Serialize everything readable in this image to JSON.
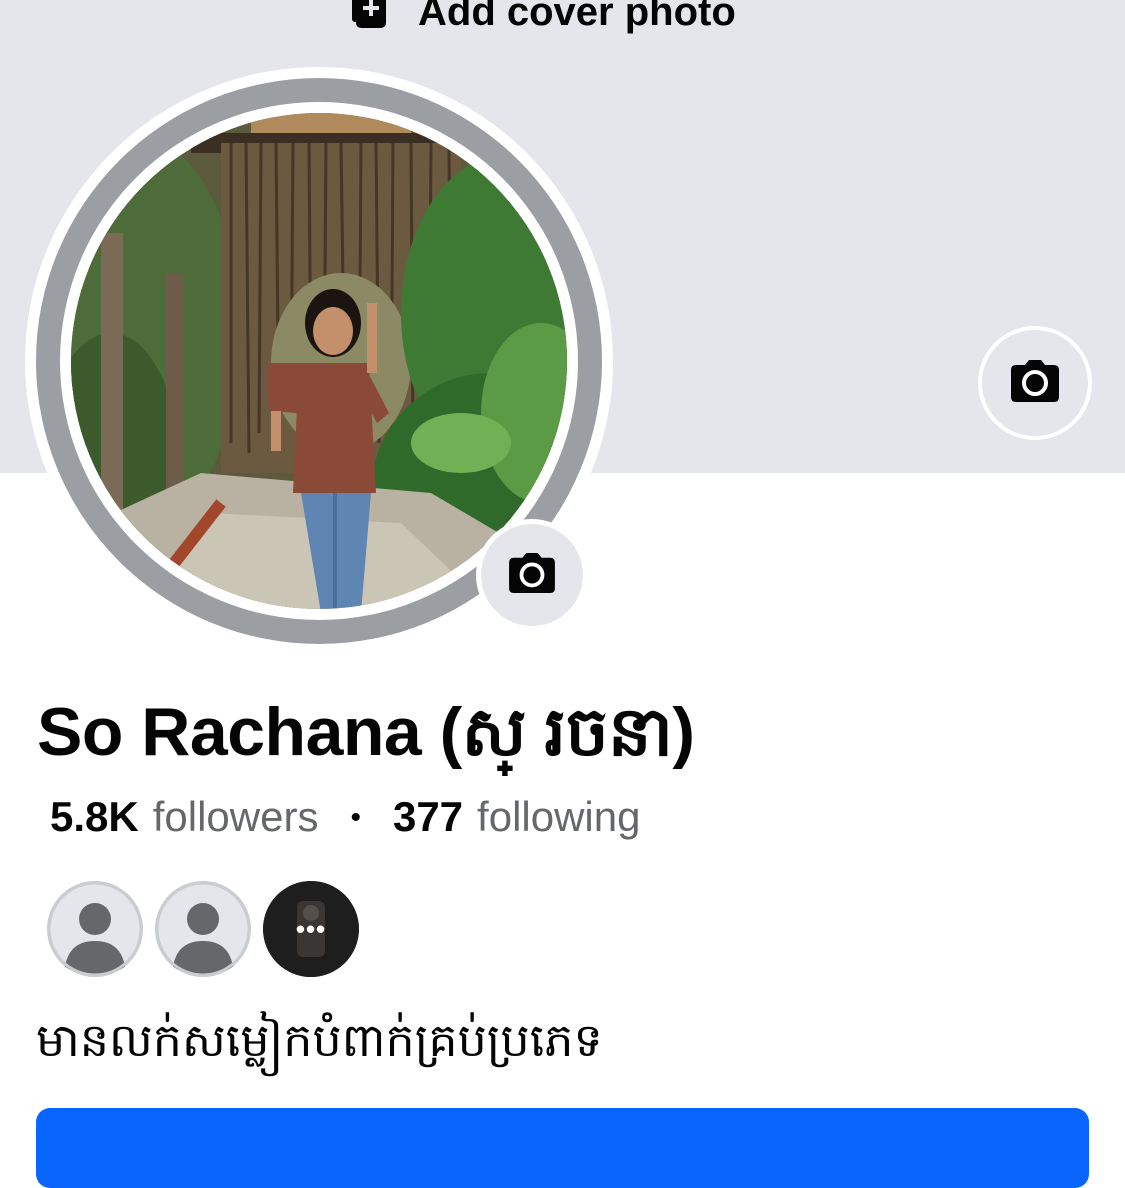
{
  "cover": {
    "add_cover_label": "Add cover photo"
  },
  "profile": {
    "name": "So Rachana (ស្ រចនា)",
    "followers_count": "5.8K",
    "followers_label": "followers",
    "separator": "•",
    "following_count": "377",
    "following_label": "following",
    "bio": "មានលក់សម្លៀកបំពាក់គ្រប់ប្រភេទ"
  },
  "mutual_friends": {
    "more_label": "•••"
  },
  "colors": {
    "cover_bg": "#e4e6eb",
    "primary_blue": "#0866ff",
    "secondary_text": "#65676b"
  }
}
